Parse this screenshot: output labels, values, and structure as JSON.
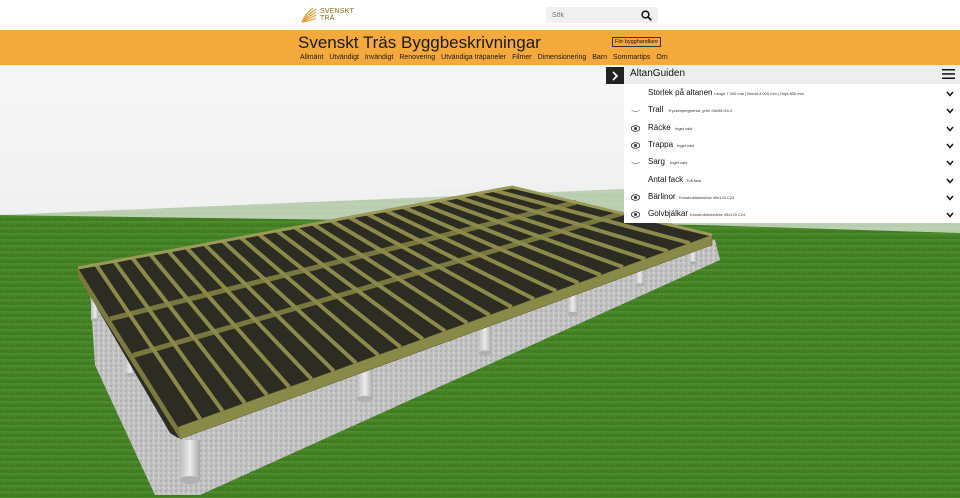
{
  "header": {
    "logo_line1": "SVENSKT",
    "logo_line2": "TRÄ",
    "search": {
      "placeholder": "Sök"
    }
  },
  "site": {
    "title": "Svenskt Träs Byggbeskrivningar",
    "trade_button": "För bygghandlare",
    "nav": [
      "Allmänt",
      "Utvändigt",
      "Invändigt",
      "Renovering",
      "Utvändiga träpaneler",
      "Filmer",
      "Dimensionering",
      "Barn",
      "Sommartips",
      "Om"
    ]
  },
  "colors": {
    "brand_orange": "#f3a93c",
    "grass": "#4b8a2b",
    "wood": "#8c8a4a",
    "gravel": "#bfbfbf"
  },
  "panel": {
    "title": "AltanGuiden",
    "rows": [
      {
        "label": "Storlek på altanen",
        "detail": "Längd 7 000 mm | Bredd 4 000 mm | Höjd 800 mm",
        "icon": "none"
      },
      {
        "label": "Trall",
        "detail": "Tryckimpregnerad, grön 28x95 G4-2",
        "icon": "eye-closed"
      },
      {
        "label": "Räcke",
        "detail": "Inget vald",
        "icon": "eye"
      },
      {
        "label": "Trappa",
        "detail": "Inget vald",
        "icon": "eye"
      },
      {
        "label": "Sarg",
        "detail": "Inget vald",
        "icon": "eye-closed"
      },
      {
        "label": "Antal fack",
        "detail": "Två fack",
        "icon": "none"
      },
      {
        "label": "Bärlinor",
        "detail": "Konstruktionsvirke 45x120 C24",
        "icon": "eye"
      },
      {
        "label": "Golvbjälkar",
        "detail": "Konstruktionsvirke 45x120 C24",
        "icon": "eye"
      }
    ]
  }
}
